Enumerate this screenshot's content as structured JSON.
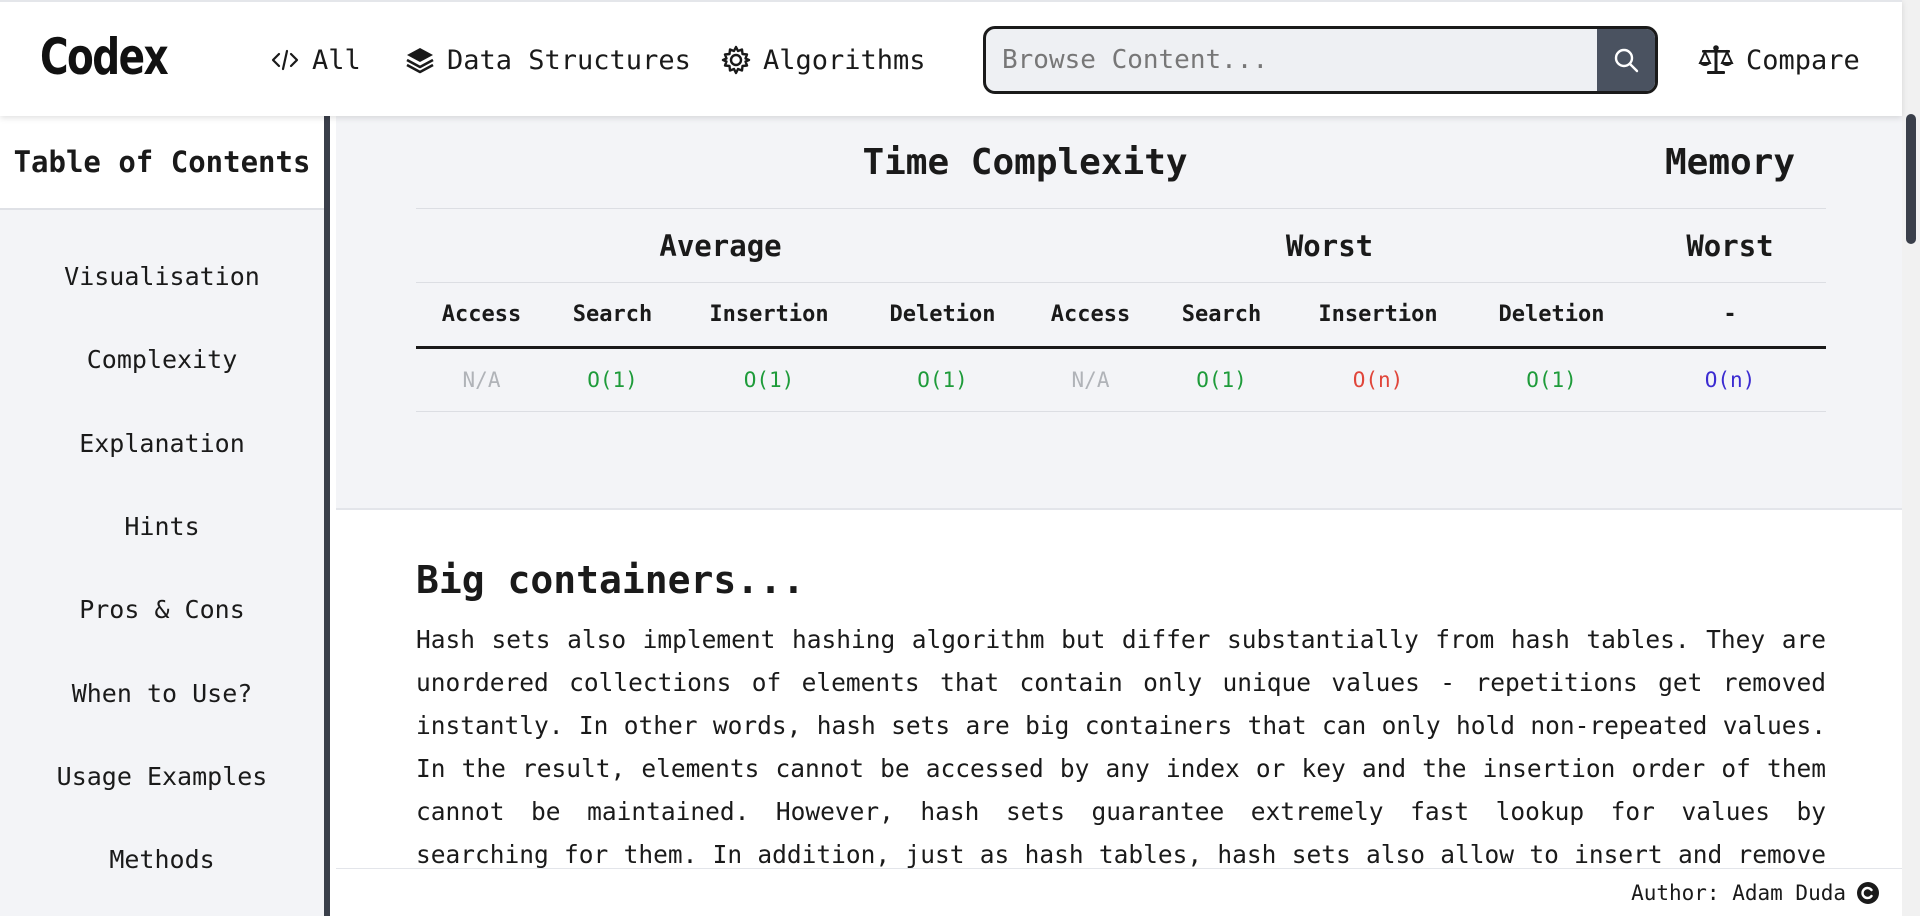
{
  "header": {
    "logo": "Codex",
    "nav": [
      {
        "label": "All",
        "icon": "code-icon"
      },
      {
        "label": "Data Structures",
        "icon": "layers-icon"
      },
      {
        "label": "Algorithms",
        "icon": "gear-icon"
      }
    ],
    "search": {
      "placeholder": "Browse Content...",
      "value": ""
    },
    "compare_label": "Compare"
  },
  "sidebar": {
    "title": "Table of Contents",
    "items": [
      {
        "label": "Visualisation"
      },
      {
        "label": "Complexity"
      },
      {
        "label": "Explanation"
      },
      {
        "label": "Hints"
      },
      {
        "label": "Pros & Cons"
      },
      {
        "label": "When to Use?"
      },
      {
        "label": "Usage Examples"
      },
      {
        "label": "Methods"
      }
    ]
  },
  "complexity": {
    "time_title": "Time Complexity",
    "memory_title": "Memory",
    "average": "Average",
    "worst": "Worst",
    "memory_worst": "Worst",
    "columns": [
      "Access",
      "Search",
      "Insertion",
      "Deletion",
      "Access",
      "Search",
      "Insertion",
      "Deletion",
      "-"
    ],
    "values": [
      {
        "text": "N/A",
        "color": "#b0b3b8"
      },
      {
        "text": "O(1)",
        "color": "#1e9b3a"
      },
      {
        "text": "O(1)",
        "color": "#1e9b3a"
      },
      {
        "text": "O(1)",
        "color": "#1e9b3a"
      },
      {
        "text": "N/A",
        "color": "#b0b3b8"
      },
      {
        "text": "O(1)",
        "color": "#1e9b3a"
      },
      {
        "text": "O(n)",
        "color": "#e0453a"
      },
      {
        "text": "O(1)",
        "color": "#1e9b3a"
      },
      {
        "text": "O(n)",
        "color": "#3b2bd1"
      }
    ]
  },
  "content": {
    "title": "Big containers...",
    "body": "Hash sets also implement hashing algorithm but differ substantially from hash tables. They are unordered collections of elements that contain only unique values - repetitions get removed instantly. In other words, hash sets are big containers that can only hold non-repeated values. In the result, elements cannot be accessed by any index or key and the insertion order of them cannot be maintained. However, hash sets guarantee extremely fast lookup for values by searching for them. In addition, just as hash tables, hash sets also allow to insert and remove data"
  },
  "footer": {
    "author": "Author: Adam Duda"
  }
}
